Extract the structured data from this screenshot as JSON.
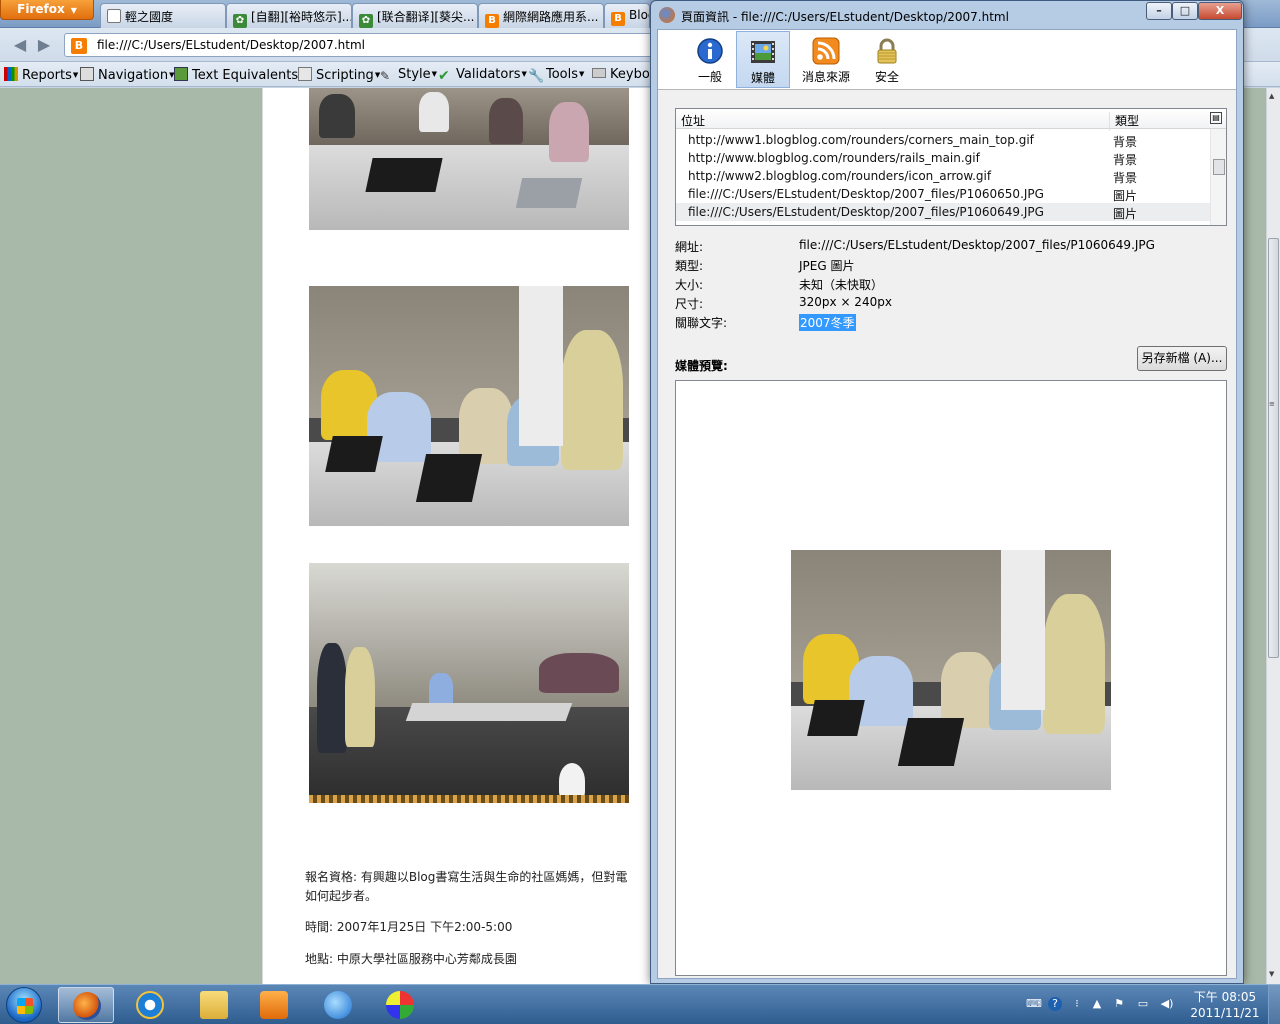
{
  "browser": {
    "app_button": "Firefox",
    "tabs": [
      {
        "label": "輕之國度",
        "icon": "blank-page-icon"
      },
      {
        "label": "[自翻][裕時悠示]...",
        "icon": "green-site-icon"
      },
      {
        "label": "[联合翻译][葵尖...",
        "icon": "green-site-icon"
      },
      {
        "label": "網際網路應用系...",
        "icon": "blogger-icon"
      },
      {
        "label": "Blog",
        "icon": "blogger-icon"
      }
    ],
    "url": "file:///C:/Users/ELstudent/Desktop/2007.html",
    "toolbar": {
      "items": [
        "Reports",
        "Navigation",
        "Text Equivalents",
        "Scripting",
        "Style",
        "Validators",
        "Tools",
        "Keybo"
      ]
    }
  },
  "page": {
    "text": {
      "line1": "報名資格: 有興趣以Blog書寫生活與生命的社區媽媽，但對電",
      "line2": "如何起步者。",
      "time": "時間: 2007年1月25日 下午2:00-5:00",
      "place": "地點: 中原大學社區服務中心芳鄰成長園"
    }
  },
  "dialog": {
    "title": "頁面資訊 - file:///C:/Users/ELstudent/Desktop/2007.html",
    "window_buttons": {
      "minimize": "–",
      "maximize": "□",
      "close": "X"
    },
    "tabs": [
      {
        "label": "一般",
        "icon": "info-icon"
      },
      {
        "label": "媒體",
        "icon": "media-icon"
      },
      {
        "label": "消息來源",
        "icon": "rss-feed-icon"
      },
      {
        "label": "安全",
        "icon": "padlock-icon"
      }
    ],
    "active_tab": "媒體",
    "media_list": {
      "columns": [
        "位址",
        "類型"
      ],
      "rows": [
        {
          "url": "http://www1.blogblog.com/rounders/corners_main_top.gif",
          "type": "背景"
        },
        {
          "url": "http://www.blogblog.com/rounders/rails_main.gif",
          "type": "背景"
        },
        {
          "url": "http://www2.blogblog.com/rounders/icon_arrow.gif",
          "type": "背景"
        },
        {
          "url": "file:///C:/Users/ELstudent/Desktop/2007_files/P1060650.JPG",
          "type": "圖片"
        },
        {
          "url": "file:///C:/Users/ELstudent/Desktop/2007_files/P1060649.JPG",
          "type": "圖片"
        }
      ],
      "selected_index": 4
    },
    "properties": {
      "address_label": "網址:",
      "address": "file:///C:/Users/ELstudent/Desktop/2007_files/P1060649.JPG",
      "type_label": "類型:",
      "type": "JPEG 圖片",
      "size_label": "大小:",
      "size": "未知（未快取）",
      "dimensions_label": "尺寸:",
      "dimensions": "320px × 240px",
      "alt_label": "關聯文字:",
      "alt": "2007冬季"
    },
    "preview_label": "媒體預覽:",
    "save_as_button": "另存新檔 (A)..."
  },
  "taskbar": {
    "apps": [
      "firefox-icon",
      "internet-explorer-icon",
      "folder-icon",
      "media-player-icon",
      "browser-globe-icon",
      "paint-icon"
    ],
    "clock": {
      "time": "下午 08:05",
      "date": "2011/11/21"
    }
  },
  "colors": {
    "page_background": "#a9b9a9",
    "selection_highlight": "#3399ff",
    "firefox_button": "#e26e0e"
  }
}
